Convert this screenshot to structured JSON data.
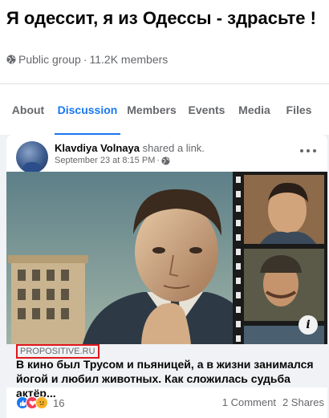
{
  "group": {
    "title": "Я одессит, я из Одессы - здрасьте !",
    "privacy": "Public group",
    "separator": "·",
    "members": "11.2K members"
  },
  "tabs": [
    {
      "label": "About"
    },
    {
      "label": "Discussion",
      "active": true
    },
    {
      "label": "Members"
    },
    {
      "label": "Events"
    },
    {
      "label": "Media"
    },
    {
      "label": "Files"
    }
  ],
  "post": {
    "author": "Klavdiya Volnaya",
    "action": " shared a link.",
    "time": "September 23 at 8:15 PM",
    "time_separator": "·",
    "link": {
      "domain": "PROPOSITIVE.RU",
      "title": "В кино был Трусом и пьяницей, а в жизни занимался йогой и любил животных. Как сложилась судьба актёр..."
    },
    "reaction_count": "16",
    "comments": "1 Comment",
    "shares": "2 Shares"
  },
  "colors": {
    "accent": "#1877f2",
    "highlight_box": "#e0161b",
    "secondary_text": "#65676b"
  }
}
